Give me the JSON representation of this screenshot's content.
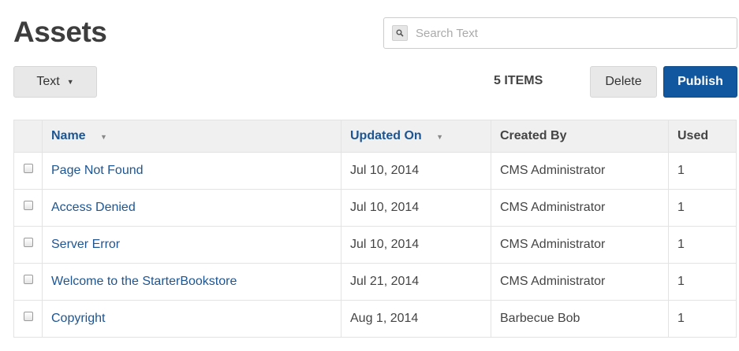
{
  "page": {
    "title": "Assets"
  },
  "search": {
    "placeholder": "Search Text",
    "value": ""
  },
  "toolbar": {
    "filter_label": "Text",
    "item_count": "5 ITEMS",
    "delete_label": "Delete",
    "publish_label": "Publish"
  },
  "table": {
    "headers": {
      "name": "Name",
      "updated_on": "Updated On",
      "created_by": "Created By",
      "used": "Used"
    },
    "rows": [
      {
        "name": "Page Not Found",
        "updated_on": "Jul 10, 2014",
        "created_by": "CMS Administrator",
        "used": "1"
      },
      {
        "name": "Access Denied",
        "updated_on": "Jul 10, 2014",
        "created_by": "CMS Administrator",
        "used": "1"
      },
      {
        "name": "Server Error",
        "updated_on": "Jul 10, 2014",
        "created_by": "CMS Administrator",
        "used": "1"
      },
      {
        "name": "Welcome to the StarterBookstore",
        "updated_on": "Jul 21, 2014",
        "created_by": "CMS Administrator",
        "used": "1"
      },
      {
        "name": "Copyright",
        "updated_on": "Aug 1, 2014",
        "created_by": "Barbecue Bob",
        "used": "1"
      }
    ]
  },
  "colors": {
    "primary": "#11579f",
    "link": "#1d5592",
    "header_bg": "#f0f0f0"
  },
  "icons": {
    "search": "search-icon",
    "dropdown": "chevron-down-icon",
    "sort": "sort-desc-icon"
  }
}
